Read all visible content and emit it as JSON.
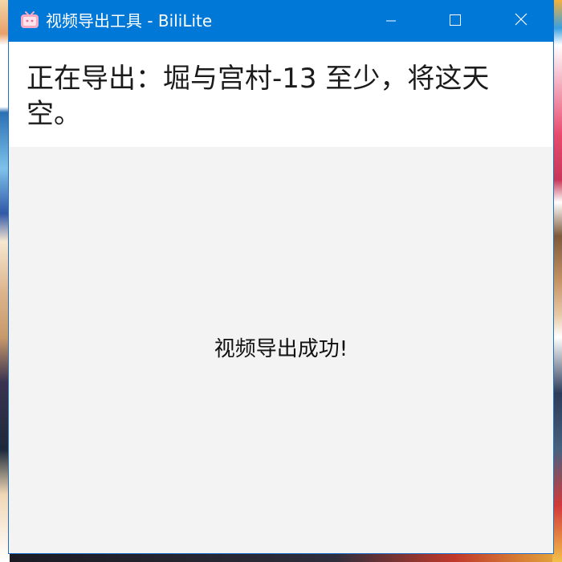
{
  "window": {
    "title": "视频导出工具 - BiliLite",
    "accent_color": "#0078d7",
    "icon": "bilibili-tv-icon",
    "controls": {
      "minimize_icon": "minimize-icon",
      "maximize_icon": "maximize-icon",
      "close_icon": "close-icon"
    }
  },
  "header": {
    "export_title": "正在导出：堀与宫村-13 至少，将这天空。"
  },
  "content": {
    "status_message": "视频导出成功!"
  }
}
